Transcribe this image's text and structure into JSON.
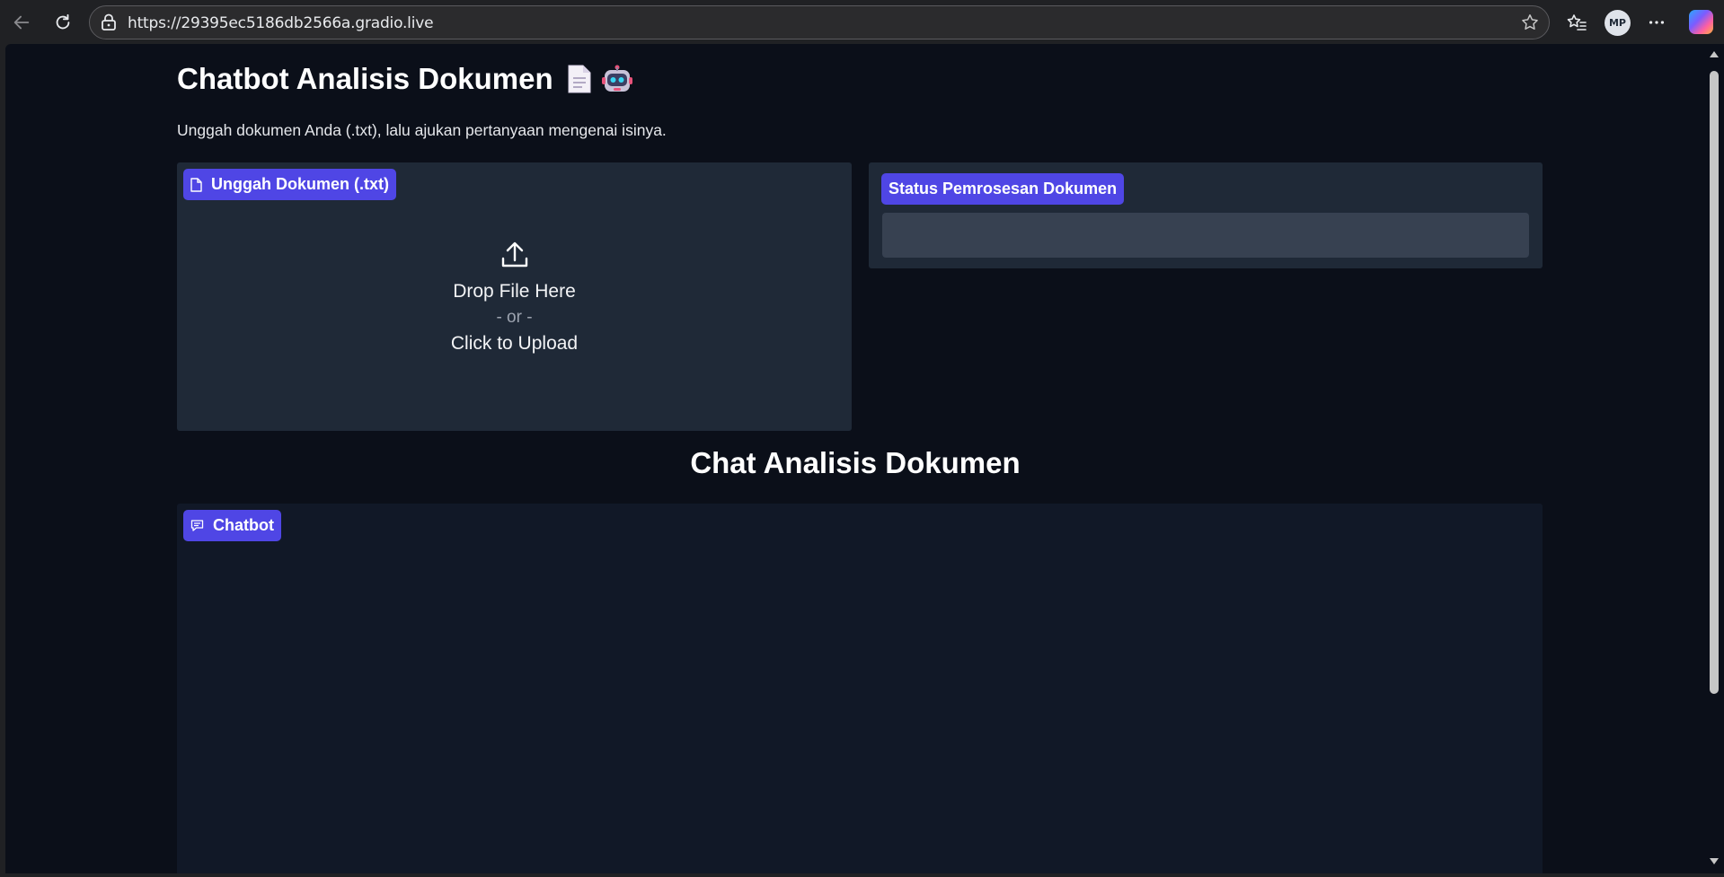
{
  "browser": {
    "url": "https://29395ec5186db2566a.gradio.live",
    "profile_initials": "MP"
  },
  "page": {
    "title": "Chatbot Analisis Dokumen",
    "title_emojis": [
      "page-icon",
      "robot-icon"
    ],
    "description": "Unggah dokumen Anda (.txt), lalu ajukan pertanyaan mengenai isinya."
  },
  "upload": {
    "label": "Unggah Dokumen (.txt)",
    "drop_text": "Drop File Here",
    "or_text": "- or -",
    "click_text": "Click to Upload"
  },
  "status": {
    "label": "Status Pemrosesan Dokumen",
    "value": ""
  },
  "chat_section": {
    "heading": "Chat Analisis Dokumen",
    "chatbot_label": "Chatbot"
  },
  "colors": {
    "background": "#0b0f19",
    "block": "#1f2937",
    "accent": "#4f46e5",
    "input": "#374151"
  }
}
